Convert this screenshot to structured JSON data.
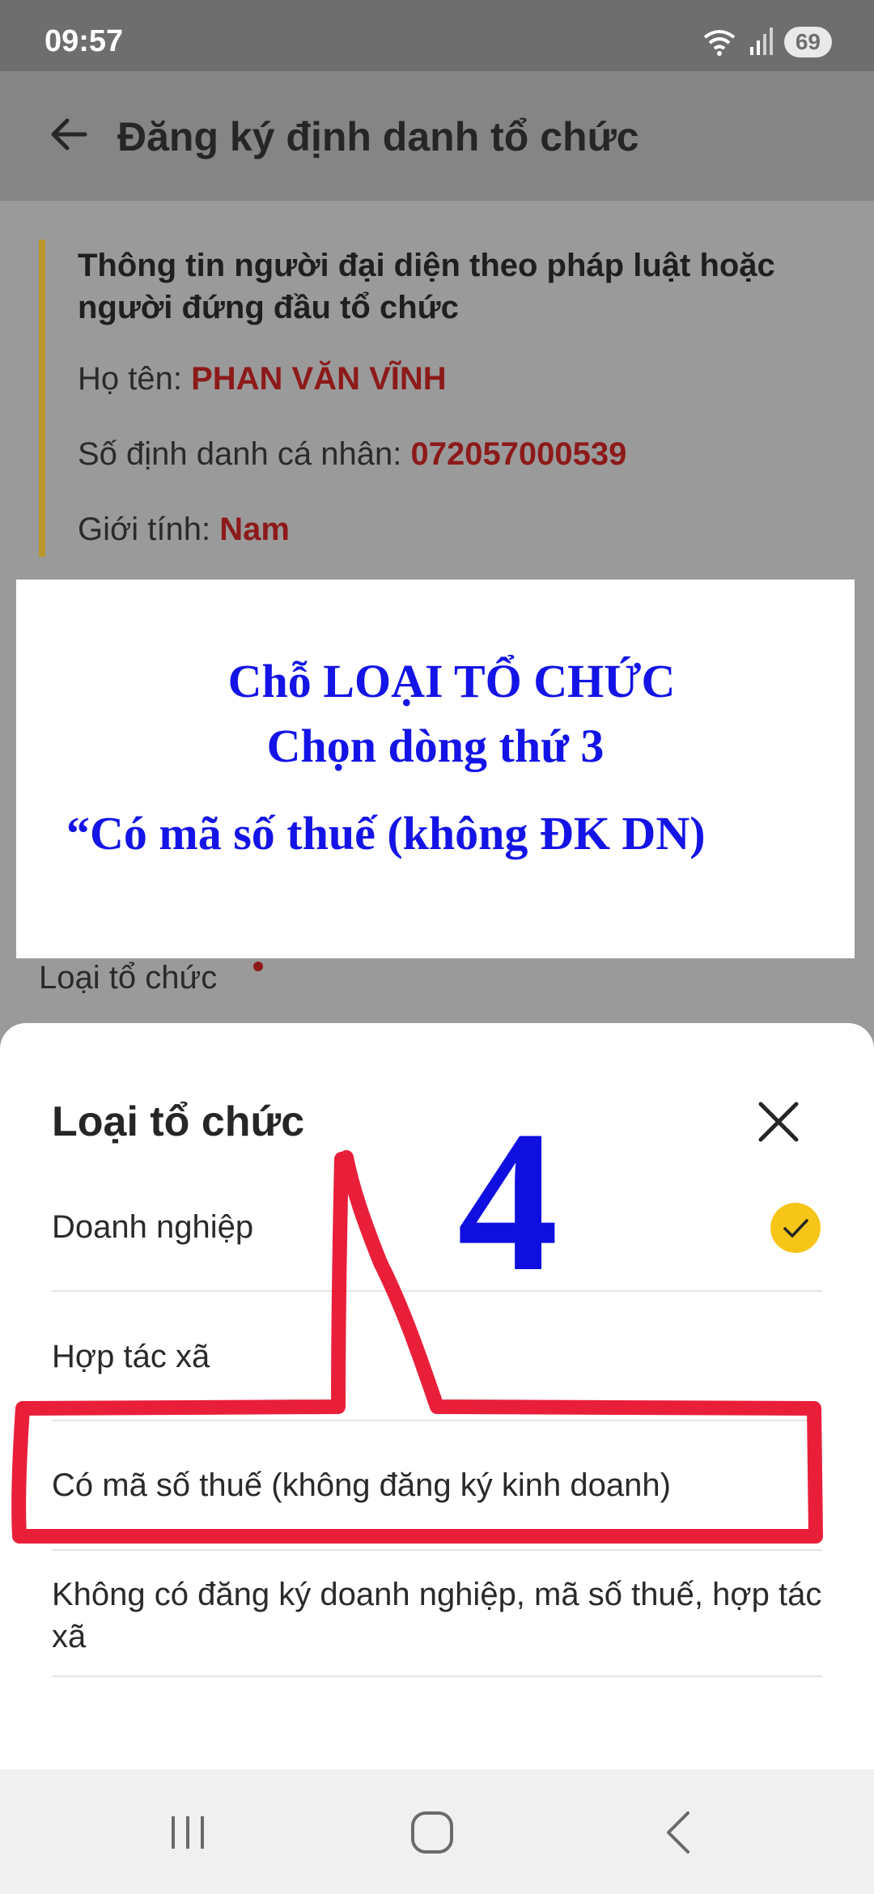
{
  "status_bar": {
    "time": "09:57",
    "battery": "69"
  },
  "header": {
    "title": "Đăng ký định danh tổ chức",
    "back_icon": "arrow-left-icon"
  },
  "info": {
    "heading": "Thông tin người đại diện theo pháp luật hoặc người đứng đầu tổ chức",
    "name_label": "Họ tên: ",
    "name_value": "PHAN VĂN VĨNH",
    "id_label": "Số định danh cá nhân: ",
    "id_value": "072057000539",
    "gender_label": "Giới tính: ",
    "gender_value": "Nam"
  },
  "annotation": {
    "line1": "Chỗ LOẠI TỔ CHỨC",
    "line2": "Chọn dòng thứ 3",
    "line3": "“Có mã số thuế (không ĐK DN)",
    "step_number": "4"
  },
  "field": {
    "label": "Loại tổ chức"
  },
  "sheet": {
    "title": "Loại tổ chức",
    "options": [
      {
        "label": "Doanh nghiệp",
        "selected": true
      },
      {
        "label": "Hợp tác xã",
        "selected": false
      },
      {
        "label": "Có mã số thuế (không đăng ký kinh doanh)",
        "selected": false
      },
      {
        "label": "Không có đăng ký doanh nghiệp, mã số thuế, hợp tác xã",
        "selected": false
      }
    ]
  },
  "colors": {
    "accent_yellow": "#f5c518",
    "value_red": "#8d1a1a",
    "annotation_blue": "#1414e6",
    "annotation_red": "#e8132f"
  }
}
